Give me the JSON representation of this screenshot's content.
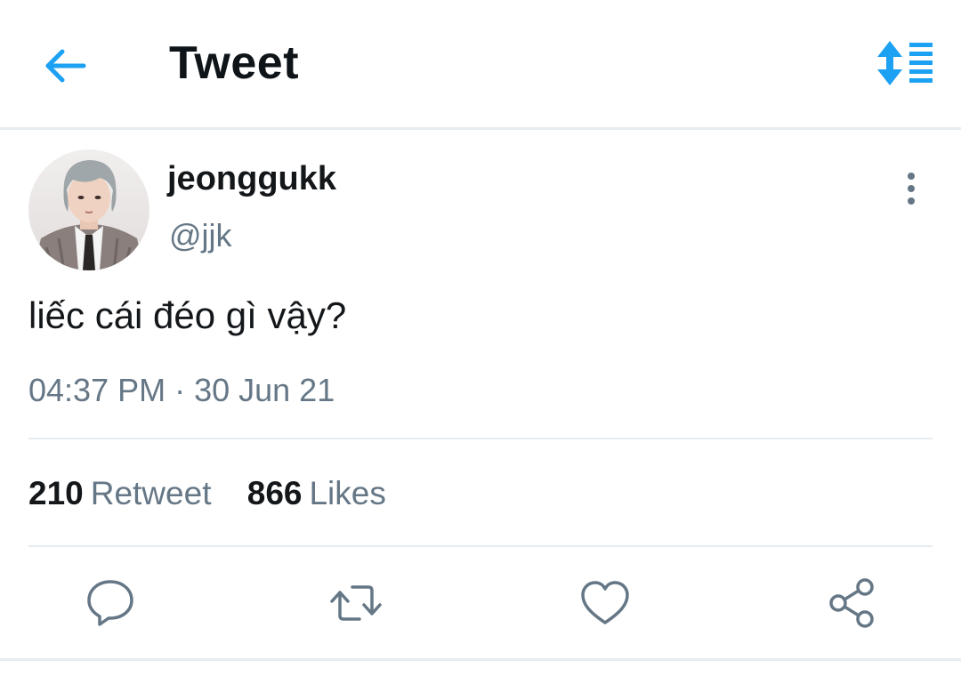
{
  "header": {
    "title": "Tweet",
    "back_icon": "arrow-left-icon",
    "sort_icon": "sort-toggle-icon"
  },
  "tweet": {
    "display_name": "jeonggukk",
    "handle": "@jjk",
    "text": "liếc cái đéo gì vậy?",
    "timestamp": "04:37 PM · 30 Jun 21",
    "retweet_count": "210",
    "retweet_label": "Retweet",
    "likes_count": "866",
    "likes_label": "Likes"
  },
  "actions": [
    {
      "name": "reply",
      "icon": "comment-icon"
    },
    {
      "name": "retweet",
      "icon": "retweet-icon"
    },
    {
      "name": "like",
      "icon": "heart-icon"
    },
    {
      "name": "share",
      "icon": "share-icon"
    }
  ],
  "colors": {
    "accent": "#1da1f2",
    "text_primary": "#14171a",
    "text_secondary": "#657786",
    "divider": "#e6ecf0"
  }
}
